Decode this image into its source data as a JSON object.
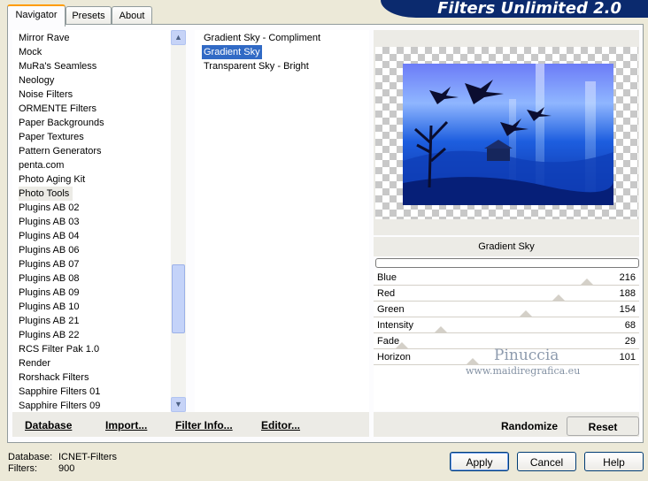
{
  "tabs": [
    {
      "label": "Navigator",
      "active": true
    },
    {
      "label": "Presets",
      "active": false
    },
    {
      "label": "About",
      "active": false
    }
  ],
  "banner": "Filters Unlimited 2.0",
  "categories": [
    "Mirror Rave",
    "Mock",
    "MuRa's Seamless",
    "Neology",
    "Noise Filters",
    "ORMENTE Filters",
    "Paper Backgrounds",
    "Paper Textures",
    "Pattern Generators",
    "penta.com",
    "Photo Aging Kit",
    "Photo Tools",
    "Plugins AB 02",
    "Plugins AB 03",
    "Plugins AB 04",
    "Plugins AB 06",
    "Plugins AB 07",
    "Plugins AB 08",
    "Plugins AB 09",
    "Plugins AB 10",
    "Plugins AB 21",
    "Plugins AB 22",
    "RCS Filter Pak 1.0",
    "Render",
    "Rorshack Filters",
    "Sapphire Filters 01",
    "Sapphire Filters 09"
  ],
  "selected_category": "Photo Tools",
  "filters": [
    "Gradient Sky - Compliment",
    "Gradient Sky",
    "Transparent Sky - Bright"
  ],
  "selected_filter": "Gradient Sky",
  "bottom_links": {
    "database": "Database",
    "import": "Import...",
    "filter_info": "Filter Info...",
    "editor": "Editor..."
  },
  "preview_filter_name": "Gradient Sky",
  "sliders": [
    {
      "label": "Blue",
      "value": "216",
      "max": 255
    },
    {
      "label": "Red",
      "value": "188",
      "max": 255
    },
    {
      "label": "Green",
      "value": "154",
      "max": 255
    },
    {
      "label": "Intensity",
      "value": "68",
      "max": 255
    },
    {
      "label": "Fade",
      "value": "29",
      "max": 255
    },
    {
      "label": "Horizon",
      "value": "101",
      "max": 255
    }
  ],
  "buttons": {
    "randomize": "Randomize",
    "reset": "Reset",
    "apply": "Apply",
    "cancel": "Cancel",
    "help": "Help"
  },
  "status": {
    "database_label": "Database:",
    "database_value": "ICNET-Filters",
    "filters_label": "Filters:",
    "filters_value": "900"
  },
  "watermark": {
    "name": "Pinuccia",
    "site": "www.maidiregrafica.eu"
  }
}
